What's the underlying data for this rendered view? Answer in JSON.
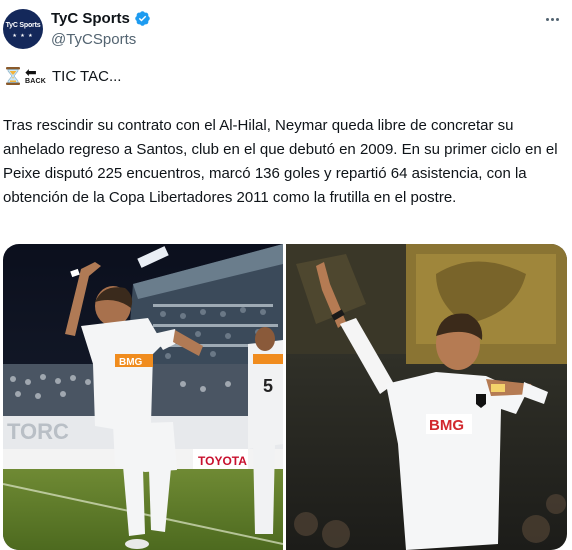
{
  "account": {
    "display_name": "TyC Sports",
    "handle": "@TyCSports",
    "avatar_text": "TyC Sports",
    "avatar_stars": "★ ★ ★",
    "verified": true
  },
  "tweet": {
    "headline": "TIC TAC...",
    "back_label": "BACK",
    "body": "Tras rescindir su contrato con el Al-Hilal, Neymar queda libre de concretar su anhelado regreso a Santos, club en el que debutó en 2009. En su primer ciclo en el Peixe disputó 225 encuentros, marcó 136 goles y repartió 64 asistencia, con la obtención de la Copa Libertadores 2011 como la frutilla en el postre."
  },
  "media": {
    "left_banner": "TORC",
    "left_ad": "TOYOTA",
    "left_jersey_number": "5",
    "jersey_sponsor": "BMG",
    "right_jersey_sponsor": "BMG"
  },
  "colors": {
    "verified_blue": "#1d9bf0",
    "avatar_bg": "#14285a",
    "secondary_text": "#536471"
  },
  "icons": {
    "hourglass": "hourglass-icon",
    "back": "back-arrow-icon",
    "verified": "verified-badge-icon",
    "more": "more-options-icon"
  }
}
